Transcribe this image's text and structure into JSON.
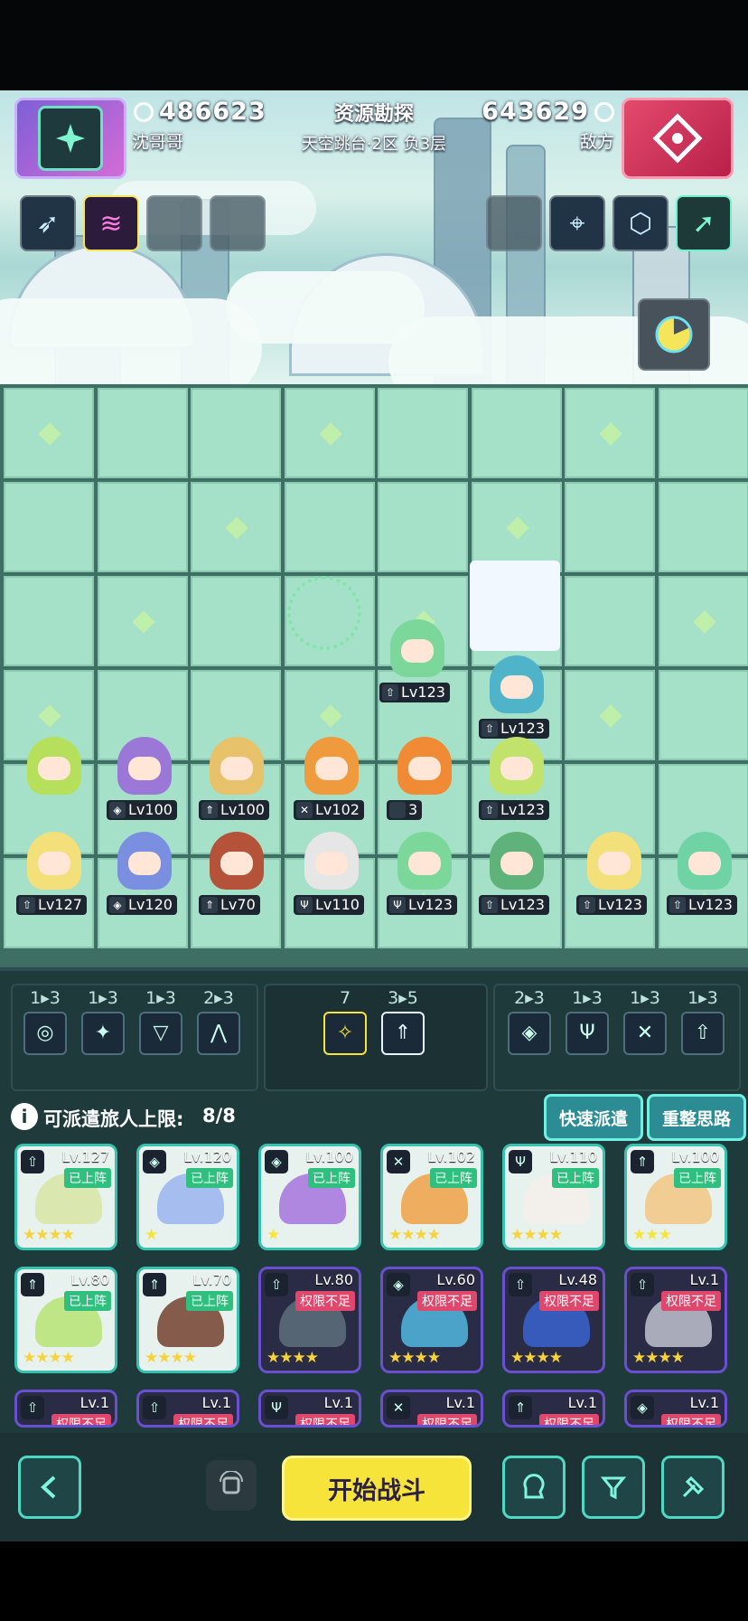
{
  "header": {
    "player_score": "486623",
    "player_name": "沈哥哥",
    "mode_title": "资源勘探",
    "location": "天空跳台·2区  负3层",
    "enemy_score": "643629",
    "enemy_name": "敌方"
  },
  "colors": {
    "accent_teal": "#36c1b1",
    "yellow": "#f7e43a",
    "tag_on": "#2fbf7e",
    "tag_off": "#e0476c",
    "panel": "#1f3a3b"
  },
  "board_units": [
    {
      "lv": "Lv123",
      "cls": "⇧",
      "color": "#7bd79a"
    },
    {
      "lv": "Lv123",
      "cls": "⇧",
      "color": "#4fb3c9"
    },
    {
      "lv": "",
      "cls": "",
      "color": "#b6e05c"
    },
    {
      "lv": "Lv100",
      "cls": "◈",
      "color": "#9b78d8"
    },
    {
      "lv": "Lv100",
      "cls": "⇑",
      "color": "#e8c26a"
    },
    {
      "lv": "Lv102",
      "cls": "✕",
      "color": "#ef9a3c"
    },
    {
      "lv": "3",
      "cls": "",
      "color": "#f08a35"
    },
    {
      "lv": "Lv123",
      "cls": "⇧",
      "color": "#c1e36c"
    },
    {
      "lv": "Lv127",
      "cls": "⇧",
      "color": "#f4e07a"
    },
    {
      "lv": "Lv120",
      "cls": "◈",
      "color": "#7a8fe0"
    },
    {
      "lv": "Lv70",
      "cls": "⇑",
      "color": "#b5533a"
    },
    {
      "lv": "Lv110",
      "cls": "Ψ",
      "color": "#e6e6e6"
    },
    {
      "lv": "Lv123",
      "cls": "Ψ",
      "color": "#7bd79a"
    },
    {
      "lv": "Lv123",
      "cls": "⇧",
      "color": "#5fb37a"
    },
    {
      "lv": "Lv123",
      "cls": "⇧",
      "color": "#f4e07a"
    },
    {
      "lv": "Lv123",
      "cls": "⇧",
      "color": "#6fd3a6"
    }
  ],
  "synergies_left": [
    {
      "count": "1▸3",
      "icon": "spiral-icon",
      "glyph": "◎"
    },
    {
      "count": "1▸3",
      "icon": "shuriken-icon",
      "glyph": "✦"
    },
    {
      "count": "1▸3",
      "icon": "arrow-shield-icon",
      "glyph": "▽"
    },
    {
      "count": "2▸3",
      "icon": "mountain-icon",
      "glyph": "⋀"
    }
  ],
  "synergies_mid": [
    {
      "count": "7",
      "icon": "sparkle-icon",
      "glyph": "✧"
    },
    {
      "count": "3▸5",
      "icon": "upgrade-icon",
      "glyph": "⇑"
    }
  ],
  "synergies_right": [
    {
      "count": "2▸3",
      "icon": "diamond-icon",
      "glyph": "◈"
    },
    {
      "count": "1▸3",
      "icon": "pillar-icon",
      "glyph": "Ψ"
    },
    {
      "count": "1▸3",
      "icon": "crossed-swords-icon",
      "glyph": "✕"
    },
    {
      "count": "1▸3",
      "icon": "bow-icon",
      "glyph": "⇧"
    }
  ],
  "deploy": {
    "label": "可派遣旅人上限:",
    "value": "8/8",
    "info": "i",
    "quick": "快速派遣",
    "reset": "重整思路"
  },
  "cards_row1": [
    {
      "lvl": "Lv.127",
      "tag": "已上阵",
      "stars": "★★★★",
      "cls": "⇧",
      "color": "#d8e6a6"
    },
    {
      "lvl": "Lv.120",
      "tag": "已上阵",
      "stars": "★",
      "cls": "◈",
      "color": "#9fb7ef"
    },
    {
      "lvl": "Lv.100",
      "tag": "已上阵",
      "stars": "★",
      "cls": "◈",
      "color": "#a97bdf"
    },
    {
      "lvl": "Lv.102",
      "tag": "已上阵",
      "stars": "★★★★",
      "cls": "✕",
      "color": "#f0a550"
    },
    {
      "lvl": "Lv.110",
      "tag": "已上阵",
      "stars": "★★★★",
      "cls": "Ψ",
      "color": "#f4f0ea"
    },
    {
      "lvl": "Lv.100",
      "tag": "已上阵",
      "stars": "★★★",
      "cls": "⇑",
      "color": "#f3c988"
    }
  ],
  "cards_row2": [
    {
      "lvl": "Lv.80",
      "tag": "已上阵",
      "stars": "★★★★",
      "cls": "⇑",
      "color": "#b9e47b"
    },
    {
      "lvl": "Lv.70",
      "tag": "已上阵",
      "stars": "★★★★",
      "cls": "⇑",
      "color": "#7a4a38"
    },
    {
      "lvl": "Lv.80",
      "tag": "权限不足",
      "stars": "★★★★",
      "cls": "⇧",
      "color": "#5b6b78"
    },
    {
      "lvl": "Lv.60",
      "tag": "权限不足",
      "stars": "★★★★",
      "cls": "◈",
      "color": "#4fb0d8"
    },
    {
      "lvl": "Lv.48",
      "tag": "权限不足",
      "stars": "★★★★",
      "cls": "⇧",
      "color": "#3860c8"
    },
    {
      "lvl": "Lv.1",
      "tag": "权限不足",
      "stars": "★★★★",
      "cls": "⇧",
      "color": "#b7b9c8"
    }
  ],
  "cards_row3": [
    {
      "lvl": "Lv.1",
      "tag": "权限不足",
      "cls": "⇧"
    },
    {
      "lvl": "Lv.1",
      "tag": "权限不足",
      "cls": "⇧"
    },
    {
      "lvl": "Lv.1",
      "tag": "权限不足",
      "cls": "Ψ"
    },
    {
      "lvl": "Lv.1",
      "tag": "权限不足",
      "cls": "✕"
    },
    {
      "lvl": "Lv.1",
      "tag": "权限不足",
      "cls": "⇑"
    },
    {
      "lvl": "Lv.1",
      "tag": "权限不足",
      "cls": "◈"
    }
  ],
  "bottom": {
    "start": "开始战斗"
  }
}
